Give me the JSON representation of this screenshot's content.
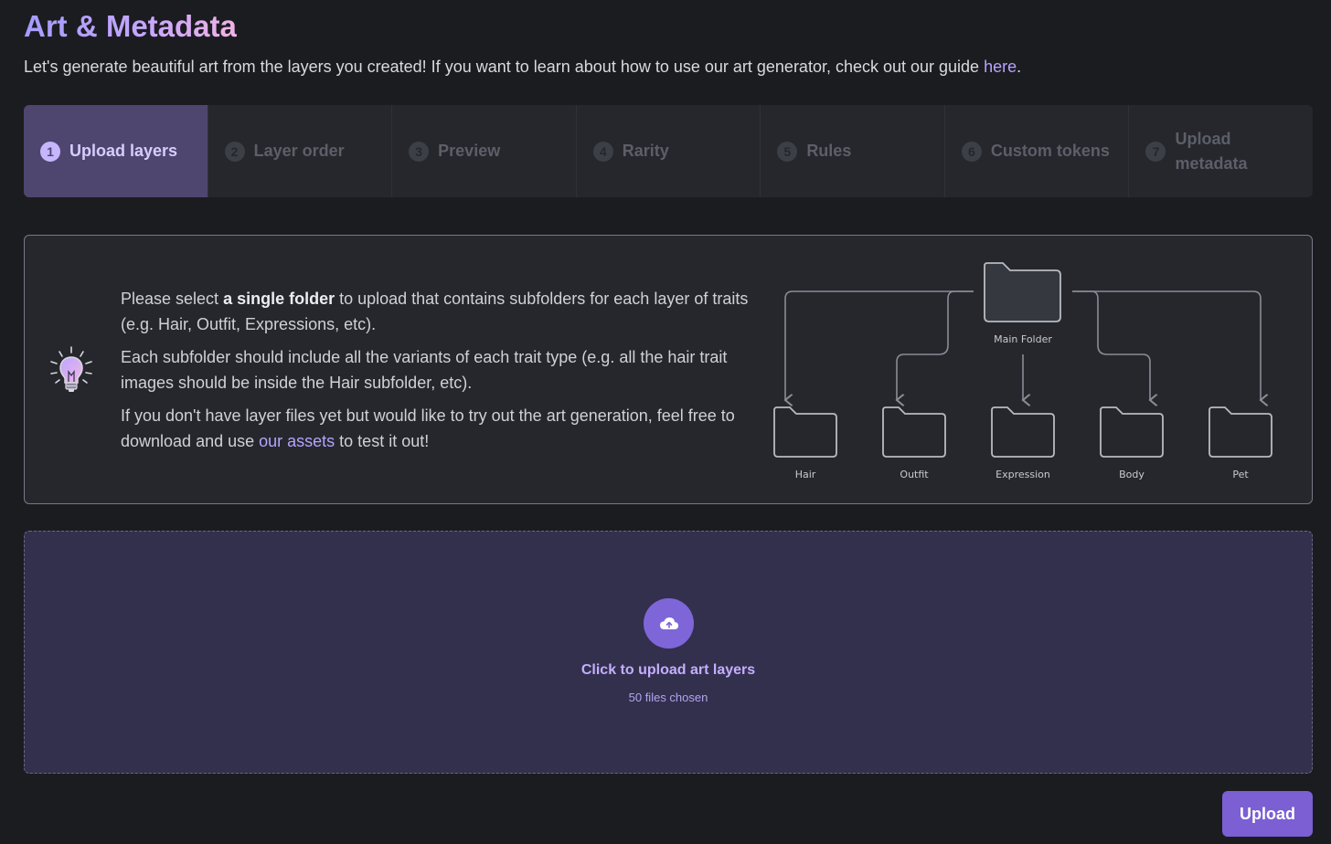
{
  "header": {
    "title": "Art & Metadata",
    "intro_text": "Let's generate beautiful art from the layers you created! If you want to learn about how to use our art generator, check out our guide ",
    "guide_link": "here",
    "intro_end": "."
  },
  "stepper": {
    "steps": [
      {
        "num": "1",
        "label": "Upload layers"
      },
      {
        "num": "2",
        "label": "Layer order"
      },
      {
        "num": "3",
        "label": "Preview"
      },
      {
        "num": "4",
        "label": "Rarity"
      },
      {
        "num": "5",
        "label": "Rules"
      },
      {
        "num": "6",
        "label": "Custom tokens"
      },
      {
        "num": "7",
        "label": "Upload metadata"
      }
    ],
    "active_step": 1
  },
  "info": {
    "p1_pre": "Please select ",
    "p1_bold": "a single folder",
    "p1_post": " to upload that contains subfolders for each layer of traits (e.g. Hair, Outfit, Expressions, etc).",
    "p2": "Each subfolder should include all the variants of each trait type (e.g. all the hair trait images should be inside the Hair subfolder, etc).",
    "p3_pre": "If you don't have layer files yet but would like to try out the art generation, feel free to download and use ",
    "p3_link": "our assets",
    "p3_post": " to test it out!",
    "icon": "lightbulb-icon",
    "diagram": {
      "main_folder": "Main Folder",
      "subfolders": [
        "Hair",
        "Outfit",
        "Expression",
        "Body",
        "Pet"
      ]
    }
  },
  "upload": {
    "icon": "cloud-upload-icon",
    "title": "Click to upload art layers",
    "status": "50 files chosen",
    "button_label": "Upload"
  },
  "colors": {
    "background": "#1b1c20",
    "panel": "#25272d",
    "accent": "#7b5fd3",
    "active_step": "#4f4670",
    "upload_zone": "#33304d"
  }
}
